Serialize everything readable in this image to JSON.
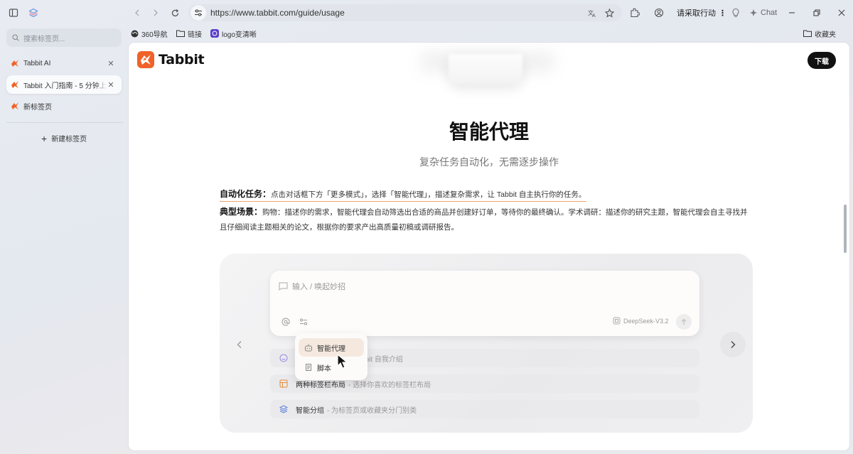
{
  "browser": {
    "url": "https://www.tabbit.com/guide/usage",
    "cta_label": "请采取行动",
    "chat_label": "Chat",
    "bookmarks": [
      {
        "label": "360导航",
        "icon": "globe-icon"
      },
      {
        "label": "链接",
        "icon": "folder-icon"
      },
      {
        "label": "logo变清晰",
        "icon": "app-icon"
      }
    ],
    "bookmarks_folder": "收藏夹"
  },
  "sidebar": {
    "search_placeholder": "搜索标签页...",
    "tabs": [
      {
        "label": "Tabbit AI",
        "active": false
      },
      {
        "label": "Tabbit 入门指南 - 5 分钟上手",
        "active": true
      },
      {
        "label": "新标签页",
        "active": false
      }
    ],
    "new_tab_label": "新建标签页"
  },
  "page": {
    "brand": "Tabbit",
    "download_label": "下载",
    "title": "智能代理",
    "subtitle": "复杂任务自动化，无需逐步操作",
    "p1_label": "自动化任务：",
    "p1_text": "点击对话框下方「更多模式」，选择「智能代理」，描述复杂需求，让 Tabbit 自主执行你的任务。",
    "p2_label": "典型场景：",
    "p2_text": "购物：描述你的需求，智能代理会自动筛选出合适的商品并创建好订单，等待你的最终确认。学术调研：描述你的研究主题，智能代理会自主寻找并且仔细阅读主题相关的论文，根据你的要求产出高质量初稿或调研报告。"
  },
  "demo": {
    "input_placeholder": "输入 / 唤起妙招",
    "model": "DeepSeek-V3.2",
    "menu": [
      {
        "label": "智能代理",
        "highlighted": true
      },
      {
        "label": "脚本",
        "highlighted": false
      }
    ],
    "suggestions": [
      {
        "title": "",
        "desc": "bbit 自我介绍"
      },
      {
        "title": "两种标签栏布局",
        "desc": "- 选择你喜欢的标签栏布局"
      },
      {
        "title": "智能分组",
        "desc": "- 为标签页或收藏夹分门别类"
      }
    ]
  },
  "colors": {
    "brand_orange": "#f0622a",
    "download_bg": "#111111",
    "highlight_underline": "#f0a56f"
  }
}
